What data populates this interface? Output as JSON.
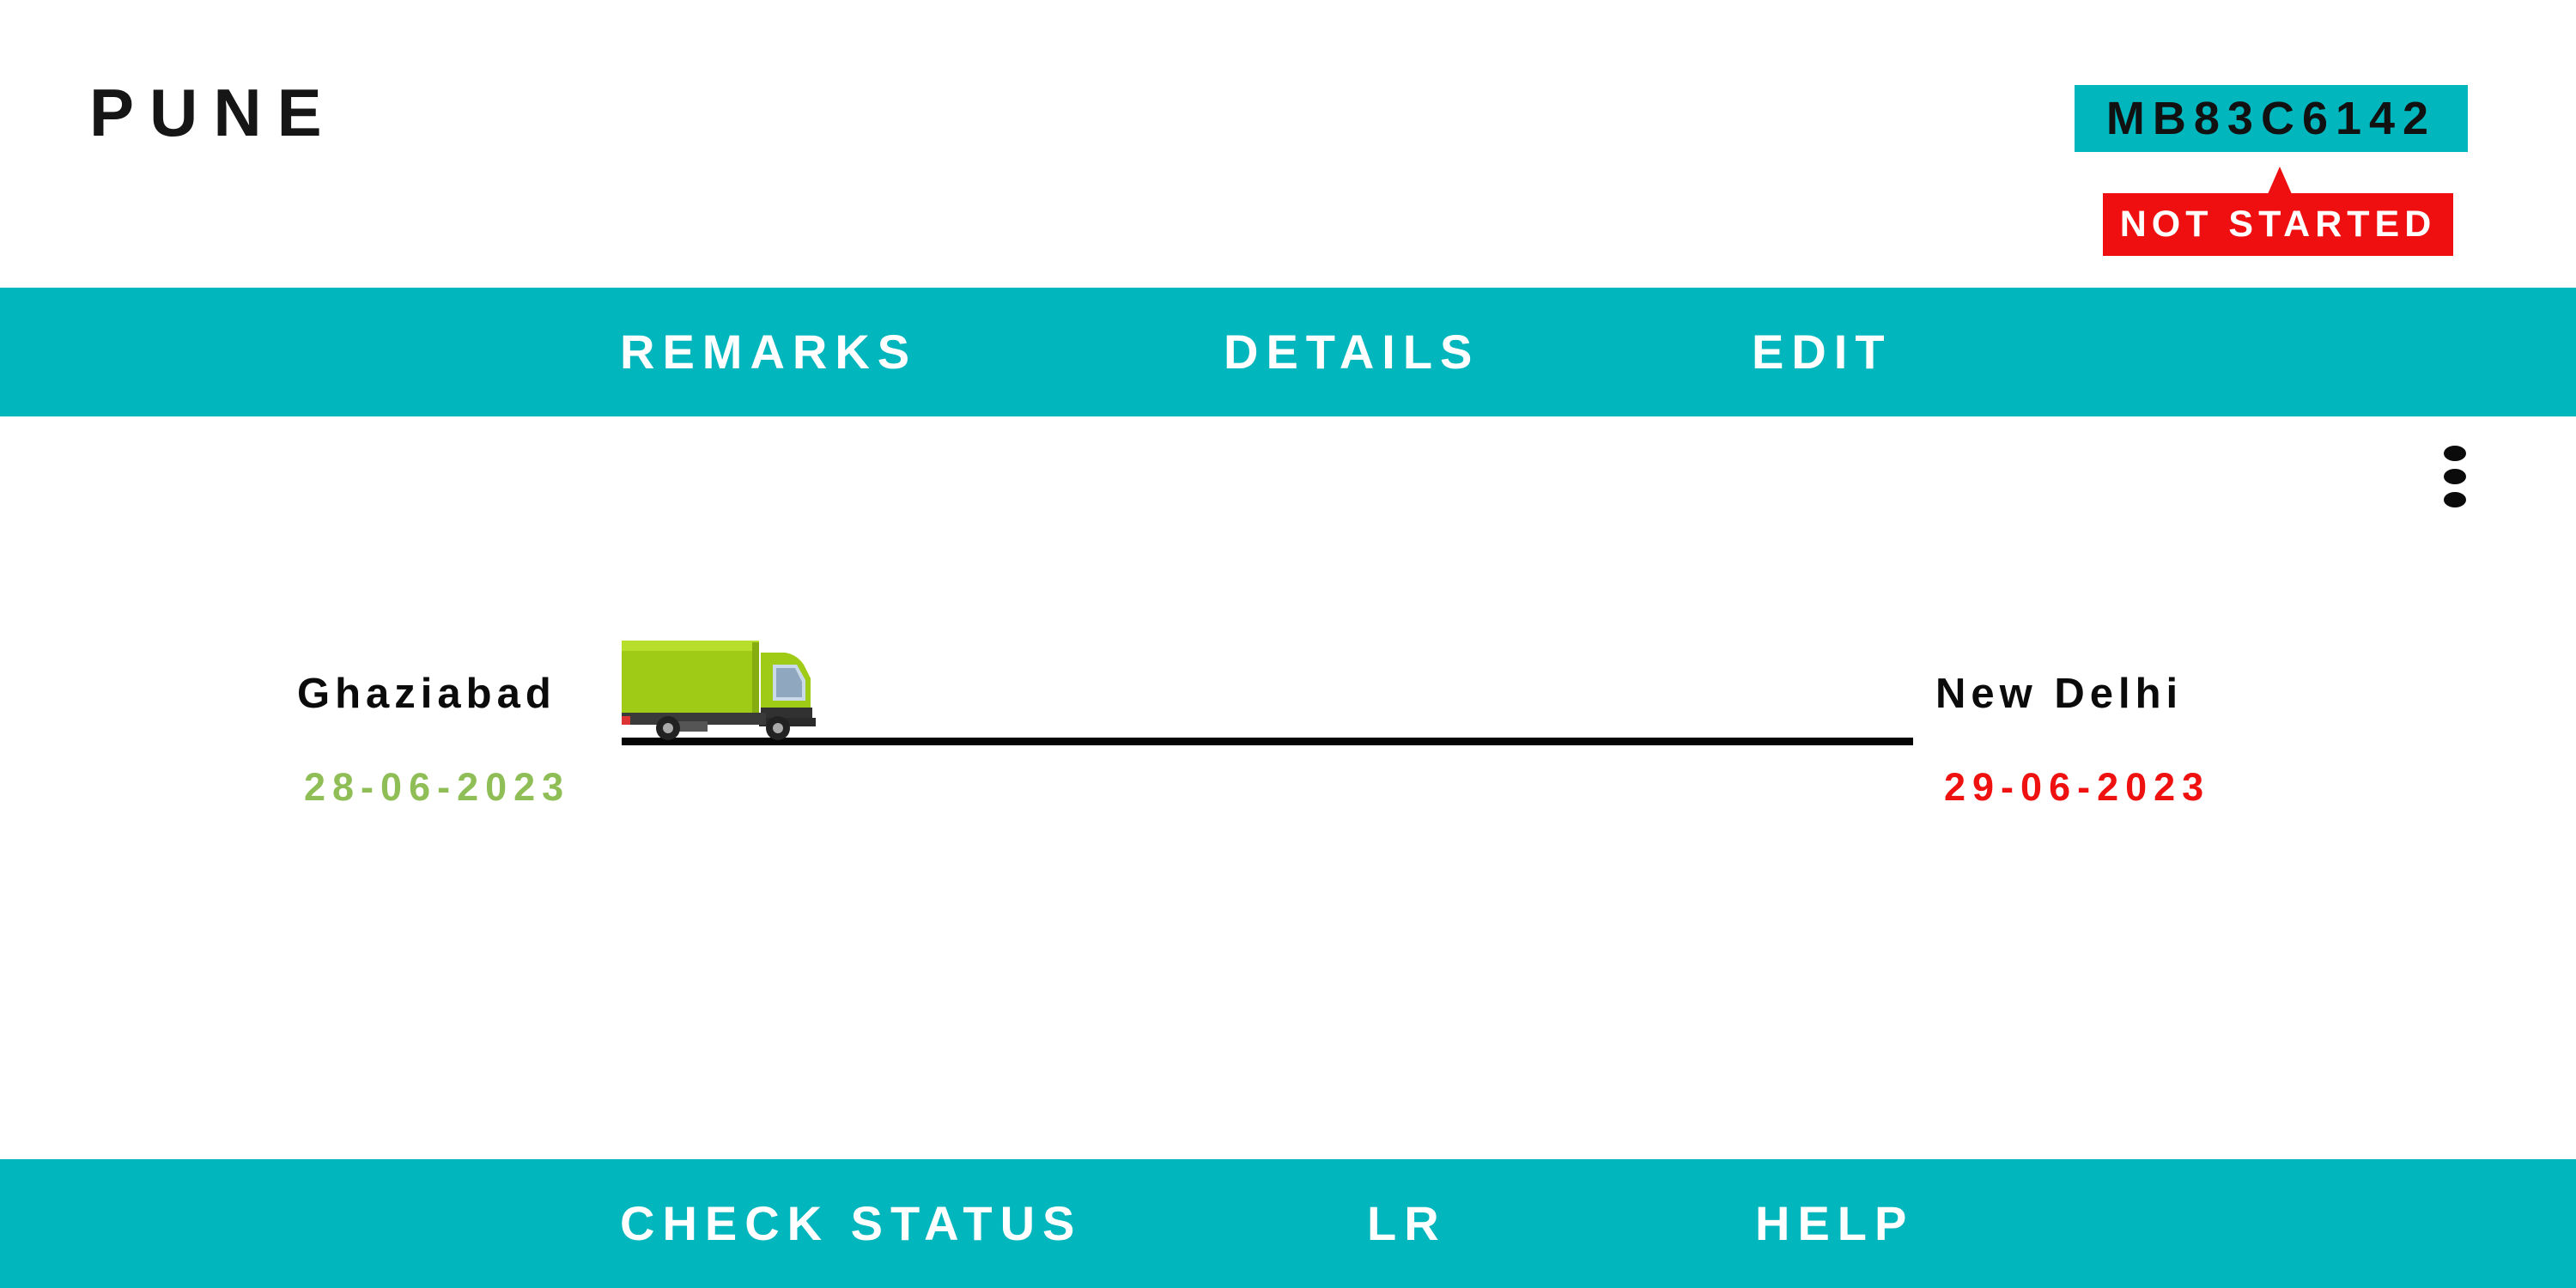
{
  "header": {
    "city": "PUNE",
    "vehicle_number": "MB83C6142",
    "status": "NOT STARTED"
  },
  "top_nav": {
    "remarks": "REMARKS",
    "details": "DETAILS",
    "edit": "EDIT"
  },
  "trip": {
    "origin": {
      "name": "Ghaziabad",
      "date": "28-06-2023",
      "date_color": "#8fbe57"
    },
    "destination": {
      "name": "New Delhi",
      "date": "29-06-2023",
      "date_color": "#ef1010"
    },
    "vehicle_icon": "truck-icon",
    "menu_icon": "kebab-menu-icon"
  },
  "bottom_nav": {
    "check_status": "CHECK STATUS",
    "lr": "LR",
    "help": "HELP"
  },
  "colors": {
    "accent": "#02b6bd",
    "status_red": "#ef0f10"
  }
}
